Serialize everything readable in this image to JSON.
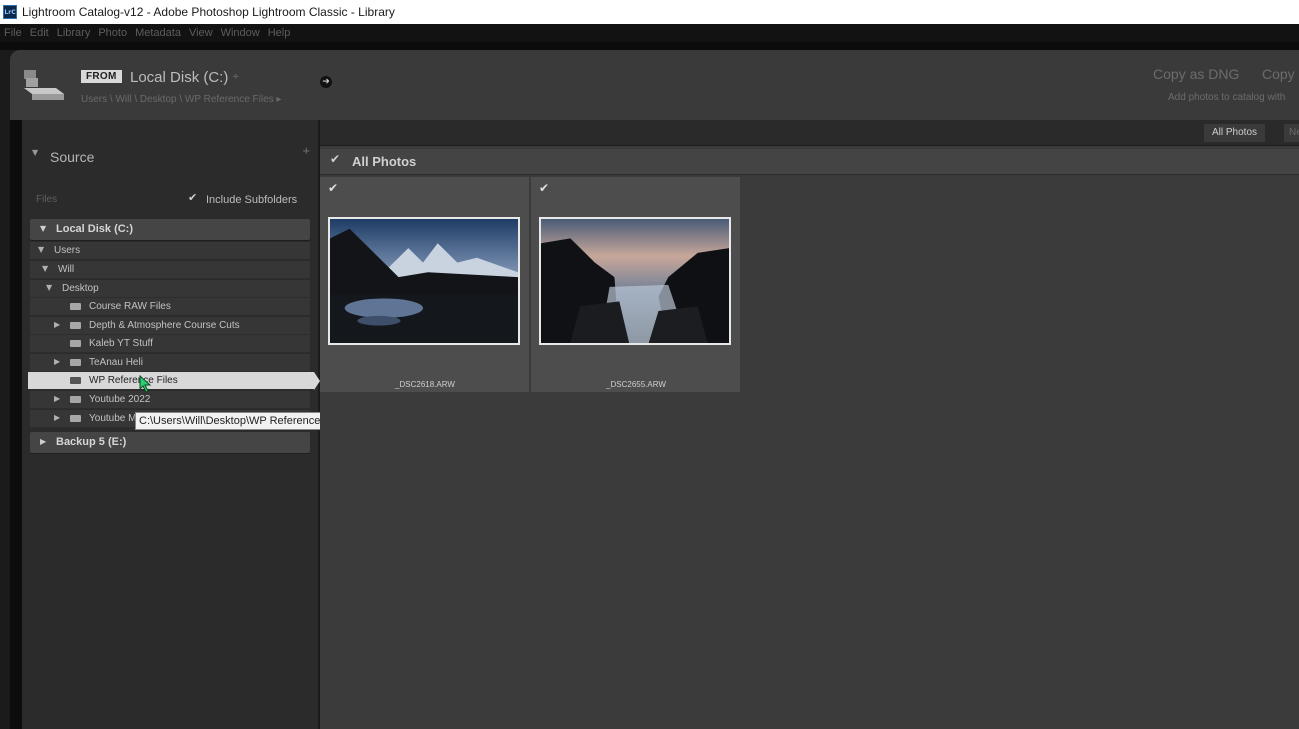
{
  "window": {
    "app_icon": "LrC",
    "title": "Lightroom Catalog-v12 - Adobe Photoshop Lightroom Classic - Library"
  },
  "menu": [
    "File",
    "Edit",
    "Library",
    "Photo",
    "Metadata",
    "View",
    "Window",
    "Help"
  ],
  "import_header": {
    "from_badge": "FROM",
    "location": "Local Disk (C:)",
    "location_chevron": "÷",
    "path": "Users \\ Will \\ Desktop \\ WP Reference Files ▸",
    "copy_as_dng": "Copy as DNG",
    "copy": "Copy",
    "add_caption": "Add photos to catalog with"
  },
  "source": {
    "title": "Source",
    "add": "+",
    "files_label": "Files",
    "include_check": "✔",
    "include_subfolders": "Include Subfolders",
    "volumes": [
      {
        "label": "Local Disk (C:)"
      },
      {
        "label": "Backup 5 (E:)"
      }
    ],
    "tree": [
      {
        "label": "Users"
      },
      {
        "label": "Will"
      },
      {
        "label": "Desktop"
      },
      {
        "label": "Course RAW Files"
      },
      {
        "label": "Depth & Atmosphere Course Cuts"
      },
      {
        "label": "Kaleb YT Stuff"
      },
      {
        "label": "TeAnau Heli"
      },
      {
        "label": "WP Reference Files"
      },
      {
        "label": "Youtube 2022"
      },
      {
        "label": "Youtube M"
      }
    ],
    "tooltip": "C:\\Users\\Will\\Desktop\\WP Reference Files"
  },
  "grid": {
    "tabs": {
      "all_photos": "All Photos",
      "new": "Ne"
    },
    "group_check": "✔",
    "group_title": "All Photos",
    "photos": [
      {
        "check": "✔",
        "filename": "_DSC2618.ARW"
      },
      {
        "check": "✔",
        "filename": "_DSC2655.ARW"
      }
    ]
  },
  "colors": {
    "background": "#1b1b1b",
    "panel": "#2b2b2b",
    "grid": "#3b3b3b",
    "cell": "#4d4d4d",
    "selection": "#d8d8d8",
    "cursor": "#2ecc71"
  }
}
